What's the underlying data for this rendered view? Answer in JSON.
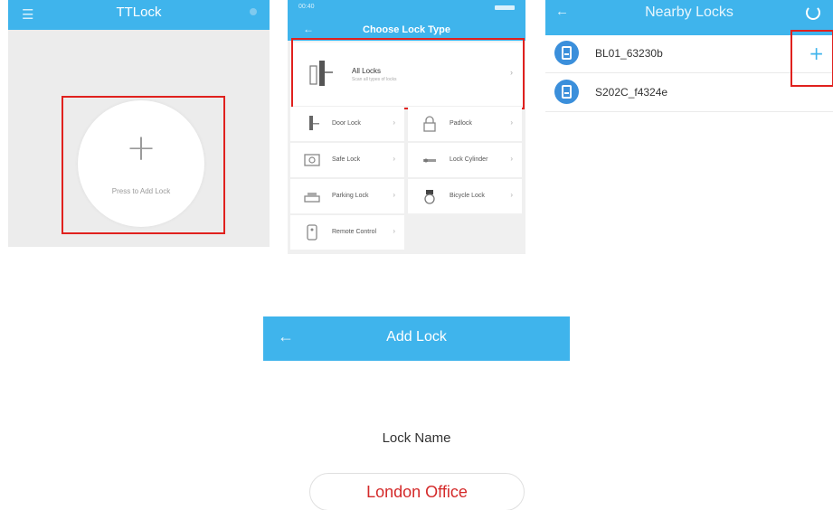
{
  "panel_home": {
    "title": "TTLock",
    "menu_icon": "menu-icon",
    "add_prompt": "Press to Add Lock"
  },
  "panel_lock_type": {
    "status_time": "00:40",
    "title": "Choose Lock Type",
    "all_locks": {
      "label": "All Locks",
      "subtitle": "Scan all types of locks"
    },
    "types": [
      {
        "label": "Door Lock",
        "icon": "door-lock-icon"
      },
      {
        "label": "Padlock",
        "icon": "padlock-icon"
      },
      {
        "label": "Safe Lock",
        "icon": "safe-lock-icon"
      },
      {
        "label": "Lock Cylinder",
        "icon": "lock-cylinder-icon"
      },
      {
        "label": "Parking Lock",
        "icon": "parking-lock-icon"
      },
      {
        "label": "Bicycle Lock",
        "icon": "bicycle-lock-icon"
      },
      {
        "label": "Remote Control",
        "icon": "remote-control-icon"
      }
    ]
  },
  "panel_nearby": {
    "title": "Nearby Locks",
    "locks": [
      {
        "name": "BL01_63230b",
        "addable": true
      },
      {
        "name": "S202C_f4324e",
        "addable": false
      }
    ]
  },
  "panel_add_lock": {
    "title": "Add Lock",
    "field_label": "Lock Name",
    "field_value": "London Office"
  },
  "colors": {
    "header_blue": "#3fb4ec",
    "highlight_red": "#e0211e",
    "lock_icon_blue": "#3b8fdb",
    "input_text_red": "#d42a2a"
  }
}
